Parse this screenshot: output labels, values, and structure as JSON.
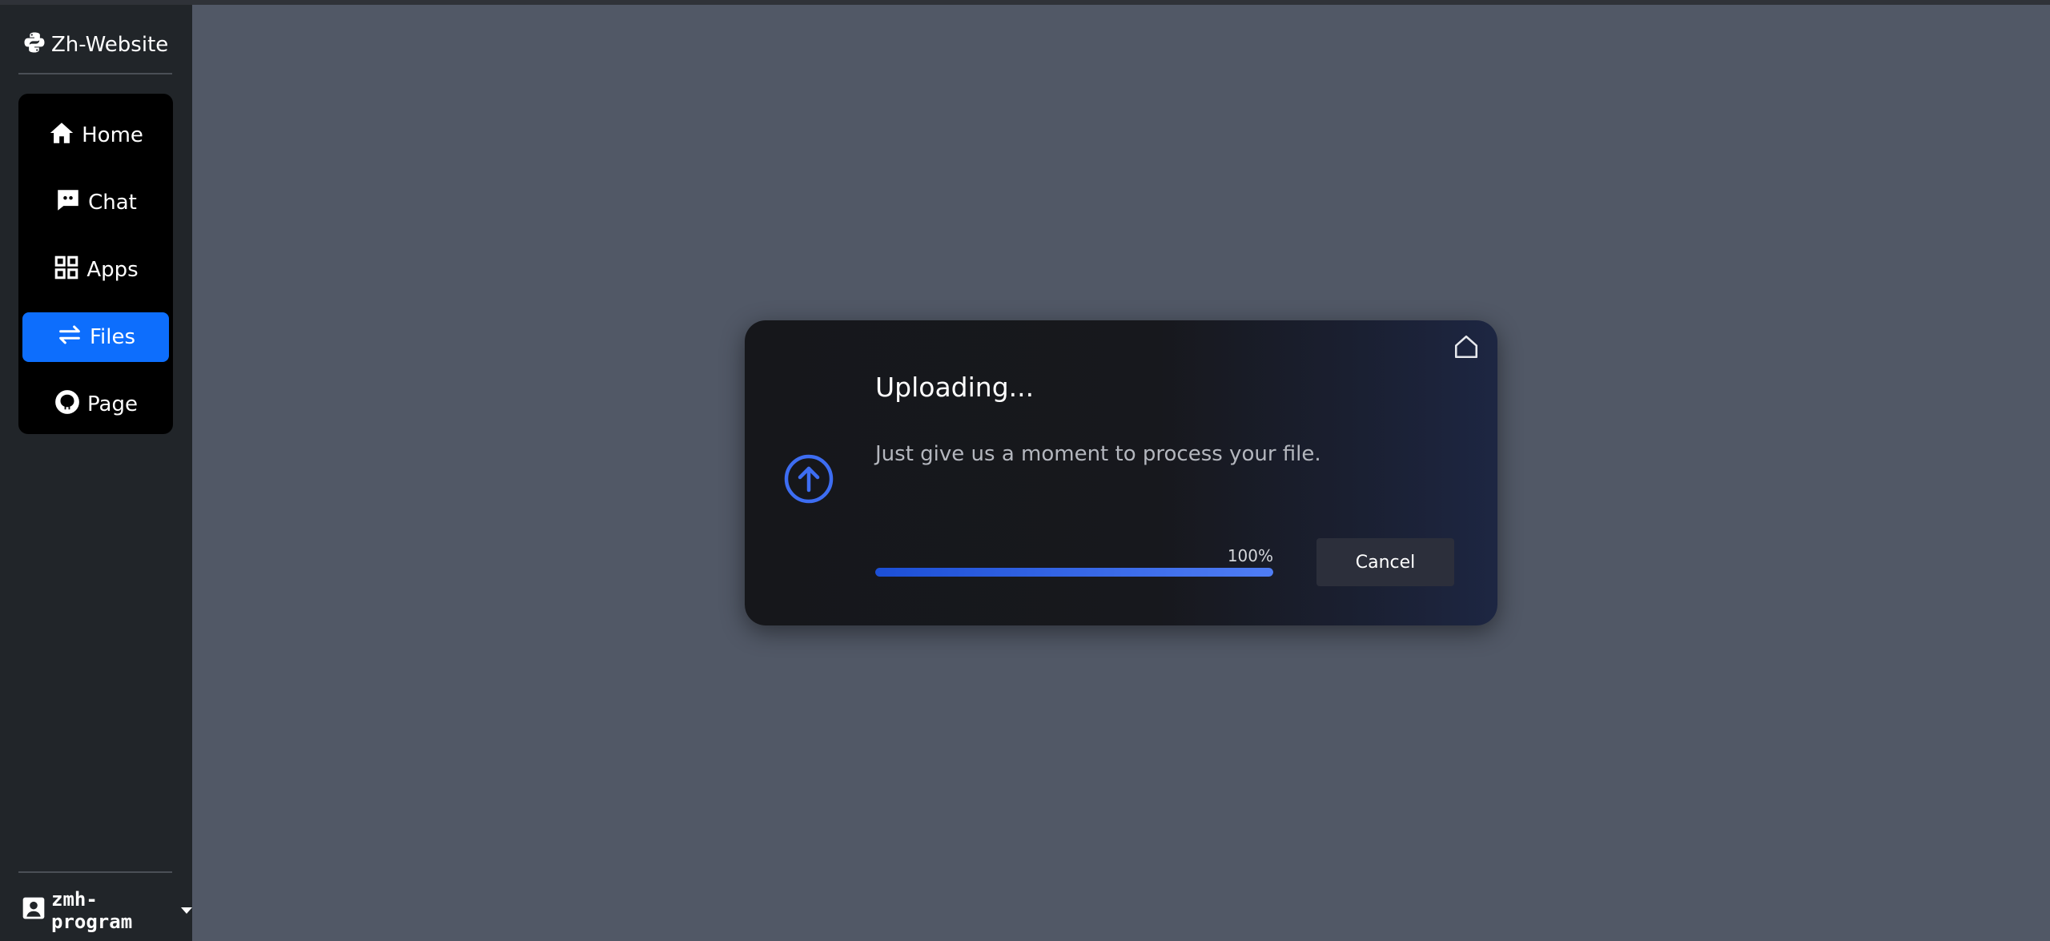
{
  "app": {
    "brand": "Zh-Website"
  },
  "sidebar": {
    "items": [
      {
        "label": "Home",
        "icon": "home-icon",
        "active": false
      },
      {
        "label": "Chat",
        "icon": "chat-icon",
        "active": false
      },
      {
        "label": "Apps",
        "icon": "grid-icon",
        "active": false
      },
      {
        "label": "Files",
        "icon": "arrows-exchange-icon",
        "active": true
      },
      {
        "label": "Page",
        "icon": "github-icon",
        "active": false
      }
    ],
    "user": {
      "name": "zmh-program",
      "icon": "person-badge-icon"
    }
  },
  "dialog": {
    "title": "Uploading...",
    "message": "Just give us a moment to process your file.",
    "progress_label": "100%",
    "progress_value": 1.0,
    "cancel_label": "Cancel",
    "icons": [
      "upload-arrow-icon",
      "home-icon"
    ]
  },
  "colors": {
    "accent": "#0d6efd",
    "progress": "#3b6cf0",
    "sidebar_bg": "#212529",
    "page_bg": "#515866"
  }
}
